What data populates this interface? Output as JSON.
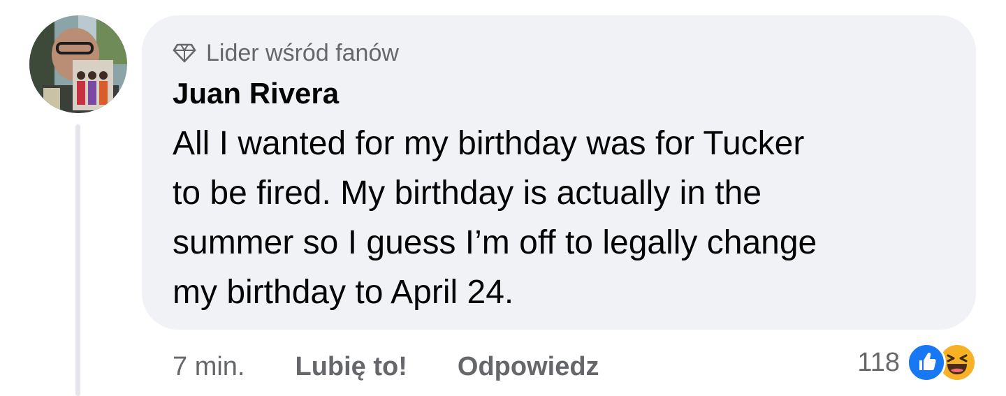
{
  "comment": {
    "badge_label": "Lider wśród fanów",
    "badge_icon": "diamond-icon",
    "author": "Juan Rivera",
    "text_lines": [
      "All I wanted for my birthday was for Tucker",
      "to be fired. My birthday is actually in the",
      "summer so I guess I’m off to legally change",
      "my birthday to April 24."
    ]
  },
  "actions": {
    "time": "7 min.",
    "like_label": "Lubię to!",
    "reply_label": "Odpowiedz"
  },
  "reactions": {
    "count": "118",
    "types": [
      "like-icon",
      "haha-icon"
    ]
  },
  "colors": {
    "bubble_bg": "#f0f2f5",
    "secondary_text": "#65676b",
    "primary_text": "#050505",
    "like_blue": "#1877f2",
    "haha_yellow": "#f7b125"
  }
}
